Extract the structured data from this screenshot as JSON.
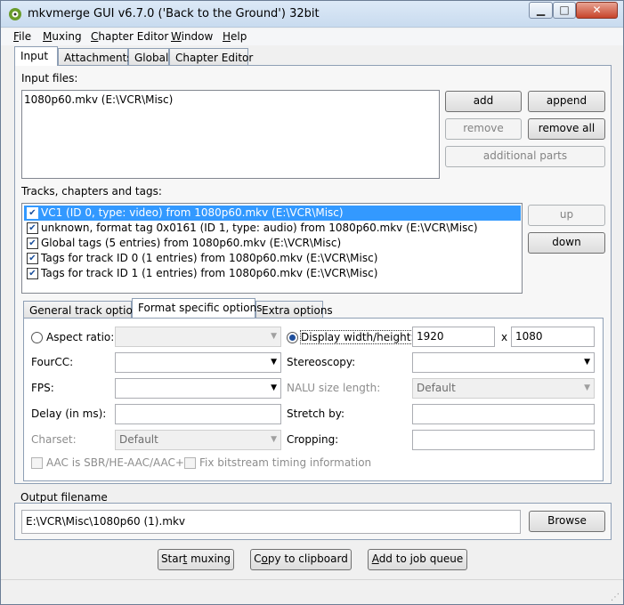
{
  "window": {
    "title": "mkvmerge GUI v6.7.0 ('Back to the Ground') 32bit",
    "minimize": "▁",
    "maximize": "□",
    "close": "✕"
  },
  "menu": [
    {
      "label": "File",
      "accel": "F",
      "rest": "ile"
    },
    {
      "label": "Muxing",
      "accel": "M",
      "rest": "uxing"
    },
    {
      "label": "Chapter Editor",
      "accel": "C",
      "rest": "hapter Editor"
    },
    {
      "label": "Window",
      "accel": "W",
      "rest": "indow"
    },
    {
      "label": "Help",
      "accel": "H",
      "rest": "elp"
    }
  ],
  "tabs": [
    "Input",
    "Attachments",
    "Global",
    "Chapter Editor"
  ],
  "input_files": {
    "label": "Input files:",
    "files": [
      "1080p60.mkv (E:\\VCR\\Misc)"
    ]
  },
  "file_buttons": {
    "add": "add",
    "append": "append",
    "remove": "remove",
    "remove_all": "remove all",
    "additional_parts": "additional parts"
  },
  "tracks": {
    "label": "Tracks, chapters and tags:",
    "items": [
      "VC1 (ID 0, type: video) from 1080p60.mkv (E:\\VCR\\Misc)",
      "unknown, format tag 0x0161 (ID 1, type: audio) from 1080p60.mkv (E:\\VCR\\Misc)",
      "Global tags (5 entries) from 1080p60.mkv (E:\\VCR\\Misc)",
      "Tags for track ID 0 (1 entries) from 1080p60.mkv (E:\\VCR\\Misc)",
      "Tags for track ID 1 (1 entries) from 1080p60.mkv (E:\\VCR\\Misc)"
    ],
    "up": "up",
    "down": "down"
  },
  "subtabs": [
    "General track options",
    "Format specific options",
    "Extra options"
  ],
  "format": {
    "aspect_ratio": "Aspect ratio:",
    "display_wh": "Display width/height:",
    "width": "1920",
    "x": "x",
    "height": "1080",
    "fourcc": "FourCC:",
    "stereoscopy": "Stereoscopy:",
    "fps": "FPS:",
    "nalu": "NALU size length:",
    "nalu_value": "Default",
    "delay": "Delay (in ms):",
    "stretch": "Stretch by:",
    "charset": "Charset:",
    "charset_value": "Default",
    "cropping": "Cropping:",
    "aac": "AAC is SBR/HE-AAC/AAC+",
    "fix_bitstream": "Fix bitstream timing information"
  },
  "output": {
    "label": "Output filename",
    "value": "E:\\VCR\\Misc\\1080p60 (1).mkv",
    "browse": "Browse"
  },
  "bottom": {
    "start_a": "Star",
    "start_u": "t",
    "start_b": " muxing",
    "copy_a": "C",
    "copy_u": "o",
    "copy_b": "py to clipboard",
    "queue_a": "",
    "queue_u": "A",
    "queue_b": "dd to job queue"
  }
}
